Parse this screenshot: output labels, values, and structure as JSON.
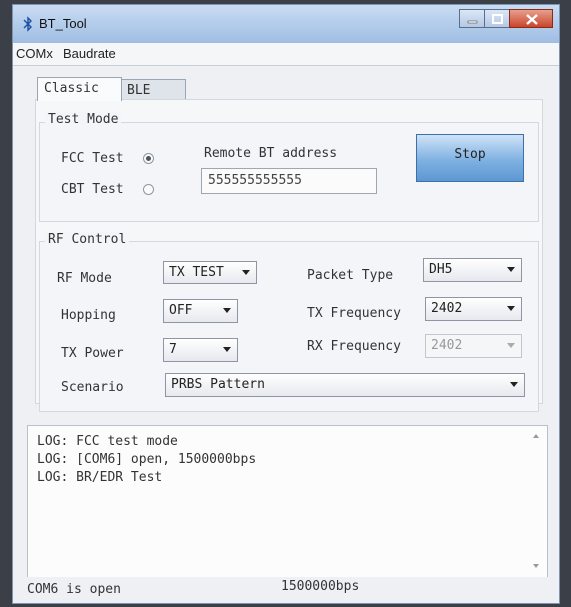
{
  "window": {
    "title": "BT_Tool"
  },
  "menu": {
    "items": [
      "COMx",
      "Baudrate"
    ]
  },
  "tabs": [
    {
      "label": "Classic",
      "active": true
    },
    {
      "label": "BLE",
      "active": false
    }
  ],
  "test_mode": {
    "title": "Test Mode",
    "fcc_label": "FCC Test",
    "fcc_checked": true,
    "cbt_label": "CBT Test",
    "cbt_checked": false,
    "remote_label": "Remote BT address",
    "remote_value": "555555555555",
    "stop_label": "Stop"
  },
  "rf_control": {
    "title": "RF Control",
    "rf_mode_label": "RF Mode",
    "rf_mode_value": "TX TEST",
    "hopping_label": "Hopping",
    "hopping_value": "OFF",
    "tx_power_label": "TX Power",
    "tx_power_value": "7",
    "scenario_label": "Scenario",
    "scenario_value": "PRBS Pattern",
    "packet_type_label": "Packet Type",
    "packet_type_value": "DH5",
    "tx_freq_label": "TX Frequency",
    "tx_freq_value": "2402",
    "rx_freq_label": "RX Frequency",
    "rx_freq_value": "2402"
  },
  "log": {
    "lines": [
      "LOG: FCC test mode",
      "LOG: [COM6] open, 1500000bps",
      "LOG: BR/EDR Test"
    ]
  },
  "status": {
    "port": "COM6 is open",
    "baud": "1500000bps"
  },
  "colors": {
    "title_bar": "#a9c6e8",
    "stop_button": "#7fb1e2",
    "window_bg": "#eef0f3"
  }
}
